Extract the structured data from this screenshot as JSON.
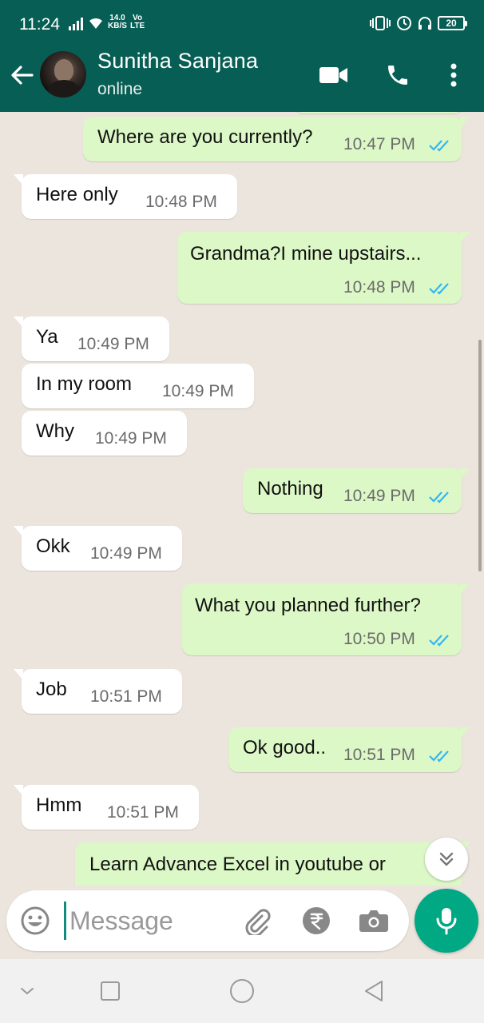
{
  "status_bar": {
    "time": "11:24",
    "speed_top": "14.0",
    "speed_bottom": "KB/S",
    "net_top": "Vo",
    "net_bottom": "LTE",
    "battery": "20"
  },
  "header": {
    "contact_name": "Sunitha Sanjana",
    "contact_status": "online"
  },
  "messages": [
    {
      "direction": "out",
      "text": "Where are you currently?",
      "time": "10:47 PM",
      "read": true
    },
    {
      "direction": "in",
      "text": "Here only",
      "time": "10:48 PM"
    },
    {
      "direction": "out",
      "text": "Grandma?I mine upstairs...",
      "time": "10:48 PM",
      "read": true
    },
    {
      "direction": "in",
      "text": "Ya",
      "time": "10:49 PM"
    },
    {
      "direction": "in",
      "text": "In my room",
      "time": "10:49 PM"
    },
    {
      "direction": "in",
      "text": "Why",
      "time": "10:49 PM"
    },
    {
      "direction": "out",
      "text": "Nothing",
      "time": "10:49 PM",
      "read": true
    },
    {
      "direction": "in",
      "text": "Okk",
      "time": "10:49 PM"
    },
    {
      "direction": "out",
      "text": "What you planned further?",
      "time": "10:50 PM",
      "read": true
    },
    {
      "direction": "in",
      "text": "Job",
      "time": "10:51 PM"
    },
    {
      "direction": "out",
      "text": "Ok good..",
      "time": "10:51 PM",
      "read": true
    },
    {
      "direction": "in",
      "text": "Hmm",
      "time": "10:51 PM"
    },
    {
      "direction": "out",
      "text": "Learn Advance Excel in youtube or",
      "time": "",
      "read": false
    }
  ],
  "composer": {
    "placeholder": "Message"
  },
  "icons": {
    "back": "arrow-left-icon",
    "video": "video-call-icon",
    "voice": "phone-icon",
    "menu": "more-vert-icon",
    "emoji": "emoji-icon",
    "attach": "paperclip-icon",
    "payment": "rupee-icon",
    "camera": "camera-icon",
    "mic": "mic-icon",
    "scroll": "double-chevron-down-icon"
  },
  "colors": {
    "header": "#075e54",
    "outgoing_bubble": "#dcf8c6",
    "incoming_bubble": "#ffffff",
    "chat_bg": "#ece5dd",
    "read_ticks": "#34b7f1",
    "mic_button": "#00a884"
  }
}
